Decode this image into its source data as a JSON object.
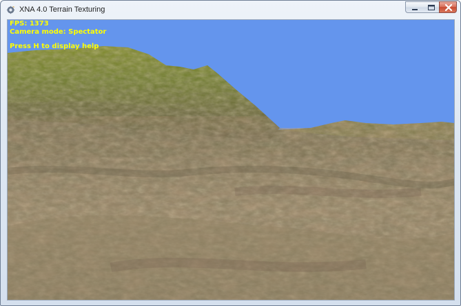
{
  "window": {
    "title": "XNA 4.0 Terrain Texturing",
    "app_icon": "xna-gear-icon",
    "controls": [
      "minimize-icon",
      "maximize-icon",
      "close-icon"
    ],
    "close_color": "#c84a31"
  },
  "viewport": {
    "sky_color": "#6495ed",
    "hud_color": "#ffff00"
  },
  "hud": {
    "fps": "FPS: 1373",
    "camera_mode": "Camera mode: Spectator",
    "help": "Press H to display help"
  }
}
